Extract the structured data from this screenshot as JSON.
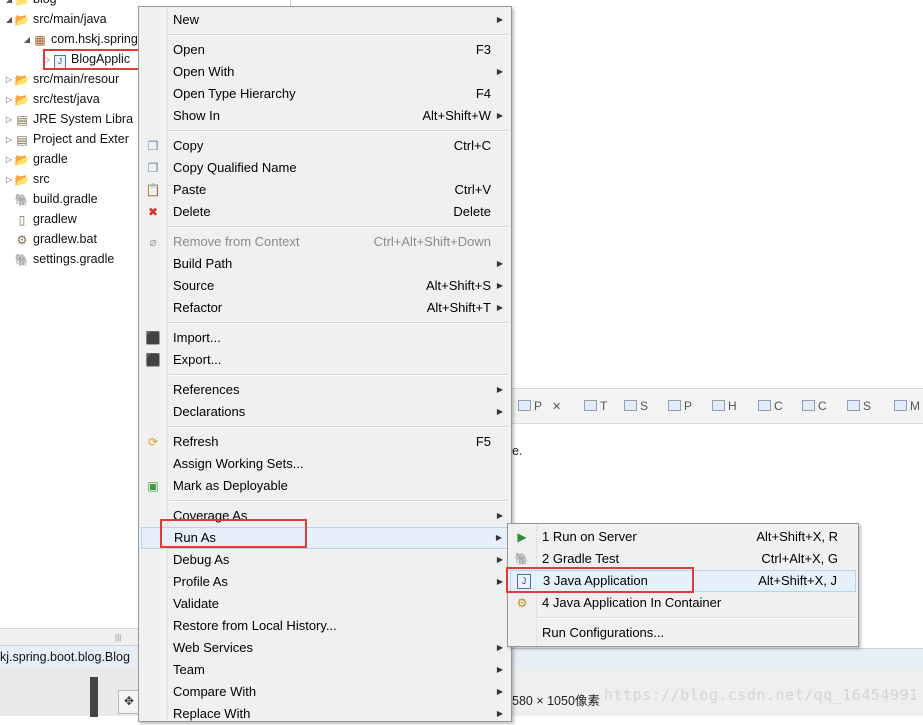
{
  "explorer": {
    "items": [
      {
        "label": "blog",
        "indent": 0,
        "twisty": "open",
        "icon": "project-icon"
      },
      {
        "label": "src/main/java",
        "indent": 1,
        "twisty": "open",
        "icon": "source-folder-icon"
      },
      {
        "label": "com.hskj.spring",
        "indent": 2,
        "twisty": "open",
        "icon": "package-icon"
      },
      {
        "label": "BlogApplic",
        "indent": 3,
        "twisty": "closed",
        "icon": "java-file-icon"
      },
      {
        "label": "src/main/resour",
        "indent": 1,
        "twisty": "closed",
        "icon": "source-folder-icon"
      },
      {
        "label": "src/test/java",
        "indent": 1,
        "twisty": "closed",
        "icon": "source-folder-icon"
      },
      {
        "label": "JRE System Libra",
        "indent": 1,
        "twisty": "closed",
        "icon": "library-icon"
      },
      {
        "label": "Project and Exter",
        "indent": 1,
        "twisty": "closed",
        "icon": "library-icon"
      },
      {
        "label": "gradle",
        "indent": 1,
        "twisty": "closed",
        "icon": "folder-icon"
      },
      {
        "label": "src",
        "indent": 1,
        "twisty": "closed",
        "icon": "folder-icon"
      },
      {
        "label": "build.gradle",
        "indent": 1,
        "twisty": "none",
        "icon": "gradle-elephant-icon"
      },
      {
        "label": "gradlew",
        "indent": 1,
        "twisty": "none",
        "icon": "file-icon"
      },
      {
        "label": "gradlew.bat",
        "indent": 1,
        "twisty": "none",
        "icon": "bat-file-icon"
      },
      {
        "label": "settings.gradle",
        "indent": 1,
        "twisty": "none",
        "icon": "gradle-elephant-icon"
      }
    ],
    "status_text": "kj.spring.boot.blog.Blog"
  },
  "views_bar": {
    "tabs": [
      {
        "label": "P",
        "icon": "problems-icon",
        "close": "✕"
      },
      {
        "label": "T",
        "icon": "tasks-icon"
      },
      {
        "label": "S",
        "icon": "servers-icon"
      },
      {
        "label": "P",
        "icon": "properties-icon"
      },
      {
        "label": "H",
        "icon": "history-icon"
      },
      {
        "label": "C",
        "icon": "console-icon"
      },
      {
        "label": "C",
        "icon": "call-hierarchy-icon"
      },
      {
        "label": "S",
        "icon": "search-icon"
      },
      {
        "label": "M",
        "icon": "markers-icon"
      }
    ],
    "content_text": "e."
  },
  "image_dims_text": "580 × 1050像素",
  "watermark": "https://blog.csdn.net/qq_16454991",
  "context_menu": {
    "items": [
      {
        "type": "item",
        "label": "New",
        "submenu": true
      },
      {
        "type": "sep"
      },
      {
        "type": "item",
        "label": "Open",
        "shortcut": "F3"
      },
      {
        "type": "item",
        "label": "Open With",
        "submenu": true
      },
      {
        "type": "item",
        "label": "Open Type Hierarchy",
        "shortcut": "F4"
      },
      {
        "type": "item",
        "label": "Show In",
        "shortcut": "Alt+Shift+W",
        "submenu": true
      },
      {
        "type": "sep"
      },
      {
        "type": "item",
        "label": "Copy",
        "shortcut": "Ctrl+C",
        "icon": "copy-icon"
      },
      {
        "type": "item",
        "label": "Copy Qualified Name",
        "icon": "copy-qualified-icon"
      },
      {
        "type": "item",
        "label": "Paste",
        "shortcut": "Ctrl+V",
        "icon": "paste-icon"
      },
      {
        "type": "item",
        "label": "Delete",
        "shortcut": "Delete",
        "icon": "delete-icon"
      },
      {
        "type": "sep"
      },
      {
        "type": "item",
        "label": "Remove from Context",
        "shortcut": "Ctrl+Alt+Shift+Down",
        "disabled": true,
        "icon": "remove-context-icon"
      },
      {
        "type": "item",
        "label": "Build Path",
        "submenu": true
      },
      {
        "type": "item",
        "label": "Source",
        "shortcut": "Alt+Shift+S",
        "submenu": true
      },
      {
        "type": "item",
        "label": "Refactor",
        "shortcut": "Alt+Shift+T",
        "submenu": true
      },
      {
        "type": "sep"
      },
      {
        "type": "item",
        "label": "Import...",
        "icon": "import-icon"
      },
      {
        "type": "item",
        "label": "Export...",
        "icon": "export-icon"
      },
      {
        "type": "sep"
      },
      {
        "type": "item",
        "label": "References",
        "submenu": true
      },
      {
        "type": "item",
        "label": "Declarations",
        "submenu": true
      },
      {
        "type": "sep"
      },
      {
        "type": "item",
        "label": "Refresh",
        "shortcut": "F5",
        "icon": "refresh-icon"
      },
      {
        "type": "item",
        "label": "Assign Working Sets..."
      },
      {
        "type": "item",
        "label": "Mark as Deployable",
        "icon": "deployable-icon"
      },
      {
        "type": "sep"
      },
      {
        "type": "item",
        "label": "Coverage As",
        "submenu": true
      },
      {
        "type": "item",
        "label": "Run As",
        "submenu": true,
        "hover": true
      },
      {
        "type": "item",
        "label": "Debug As",
        "submenu": true
      },
      {
        "type": "item",
        "label": "Profile As",
        "submenu": true
      },
      {
        "type": "item",
        "label": "Validate"
      },
      {
        "type": "item",
        "label": "Restore from Local History..."
      },
      {
        "type": "item",
        "label": "Web Services",
        "submenu": true
      },
      {
        "type": "item",
        "label": "Team",
        "submenu": true
      },
      {
        "type": "item",
        "label": "Compare With",
        "submenu": true
      },
      {
        "type": "item",
        "label": "Replace With",
        "submenu": true
      }
    ]
  },
  "run_as_menu": {
    "items": [
      {
        "type": "item",
        "label": "1 Run on Server",
        "shortcut": "Alt+Shift+X, R",
        "icon": "run-on-server-icon"
      },
      {
        "type": "item",
        "label": "2 Gradle Test",
        "shortcut": "Ctrl+Alt+X, G",
        "icon": "gradle-elephant-icon"
      },
      {
        "type": "item",
        "label": "3 Java Application",
        "shortcut": "Alt+Shift+X, J",
        "icon": "java-application-icon",
        "hover": true
      },
      {
        "type": "item",
        "label": "4 Java Application In Container",
        "icon": "java-container-icon"
      },
      {
        "type": "sep"
      },
      {
        "type": "item",
        "label": "Run Configurations..."
      }
    ]
  },
  "colors": {
    "highlight_box": "#e03a3a",
    "menu_bg": "#f0f0f0",
    "hover_bg": "#e5f0fb"
  }
}
